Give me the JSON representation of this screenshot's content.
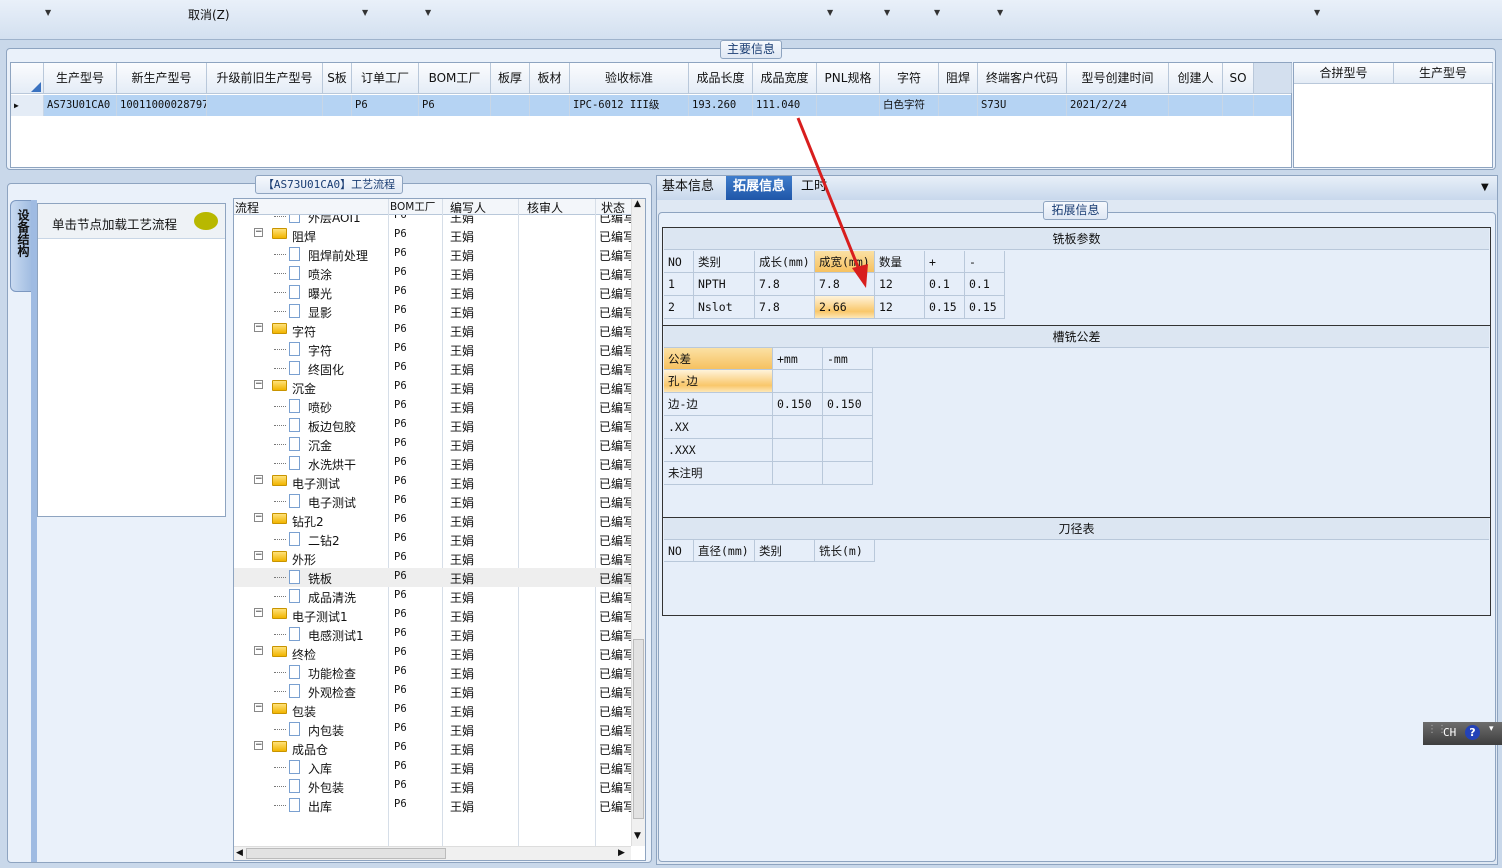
{
  "toolbar": {
    "cancel_label": "取消(Z)"
  },
  "main_info": {
    "title": "主要信息",
    "columns": [
      "生产型号",
      "新生产型号",
      "升级前旧生产型号",
      "S板",
      "订单工厂",
      "BOM工厂",
      "板厚",
      "板材",
      "验收标准",
      "成品长度",
      "成品宽度",
      "PNL规格",
      "字符",
      "阻焊",
      "终端客户代码",
      "型号创建时间",
      "创建人",
      "SO"
    ],
    "rows": [
      [
        "AS73U01CA0",
        "10011000028797",
        "",
        "",
        "P6",
        "P6",
        "",
        "",
        "IPC-6012 III级",
        "193.260",
        "111.040",
        "",
        "白色字符",
        "",
        "S73U",
        "2021/2/24",
        "",
        ""
      ]
    ],
    "merge_columns": [
      "合拼型号",
      "生产型号"
    ]
  },
  "process": {
    "title": "【AS73U01CA0】工艺流程",
    "side_tab": "设备结构",
    "hint": "单击节点加载工艺流程",
    "columns": [
      "流程",
      "BOM工厂",
      "编写人",
      "核审人",
      "状态"
    ],
    "rows": [
      {
        "name": "外层AOI1",
        "level": 2,
        "bom": "P6",
        "writer": "王娟",
        "reviewer": "",
        "status": "已编写"
      },
      {
        "name": "阻焊",
        "level": 1,
        "bom": "P6",
        "writer": "王娟",
        "reviewer": "",
        "status": "已编写"
      },
      {
        "name": "阻焊前处理",
        "level": 2,
        "bom": "P6",
        "writer": "王娟",
        "reviewer": "",
        "status": "已编写"
      },
      {
        "name": "喷涂",
        "level": 2,
        "bom": "P6",
        "writer": "王娟",
        "reviewer": "",
        "status": "已编写"
      },
      {
        "name": "曝光",
        "level": 2,
        "bom": "P6",
        "writer": "王娟",
        "reviewer": "",
        "status": "已编写"
      },
      {
        "name": "显影",
        "level": 2,
        "bom": "P6",
        "writer": "王娟",
        "reviewer": "",
        "status": "已编写"
      },
      {
        "name": "字符",
        "level": 1,
        "bom": "P6",
        "writer": "王娟",
        "reviewer": "",
        "status": "已编写"
      },
      {
        "name": "字符",
        "level": 2,
        "bom": "P6",
        "writer": "王娟",
        "reviewer": "",
        "status": "已编写"
      },
      {
        "name": "终固化",
        "level": 2,
        "bom": "P6",
        "writer": "王娟",
        "reviewer": "",
        "status": "已编写"
      },
      {
        "name": "沉金",
        "level": 1,
        "bom": "P6",
        "writer": "王娟",
        "reviewer": "",
        "status": "已编写"
      },
      {
        "name": "喷砂",
        "level": 2,
        "bom": "P6",
        "writer": "王娟",
        "reviewer": "",
        "status": "已编写"
      },
      {
        "name": "板边包胶",
        "level": 2,
        "bom": "P6",
        "writer": "王娟",
        "reviewer": "",
        "status": "已编写"
      },
      {
        "name": "沉金",
        "level": 2,
        "bom": "P6",
        "writer": "王娟",
        "reviewer": "",
        "status": "已编写"
      },
      {
        "name": "水洗烘干",
        "level": 2,
        "bom": "P6",
        "writer": "王娟",
        "reviewer": "",
        "status": "已编写"
      },
      {
        "name": "电子测试",
        "level": 1,
        "bom": "P6",
        "writer": "王娟",
        "reviewer": "",
        "status": "已编写"
      },
      {
        "name": "电子测试",
        "level": 2,
        "bom": "P6",
        "writer": "王娟",
        "reviewer": "",
        "status": "已编写"
      },
      {
        "name": "钻孔2",
        "level": 1,
        "bom": "P6",
        "writer": "王娟",
        "reviewer": "",
        "status": "已编写"
      },
      {
        "name": "二钻2",
        "level": 2,
        "bom": "P6",
        "writer": "王娟",
        "reviewer": "",
        "status": "已编写"
      },
      {
        "name": "外形",
        "level": 1,
        "bom": "P6",
        "writer": "王娟",
        "reviewer": "",
        "status": "已编写"
      },
      {
        "name": "铣板",
        "level": 2,
        "bom": "P6",
        "writer": "王娟",
        "reviewer": "",
        "status": "已编写",
        "selected": true
      },
      {
        "name": "成品清洗",
        "level": 2,
        "bom": "P6",
        "writer": "王娟",
        "reviewer": "",
        "status": "已编写"
      },
      {
        "name": "电子测试1",
        "level": 1,
        "bom": "P6",
        "writer": "王娟",
        "reviewer": "",
        "status": "已编写"
      },
      {
        "name": "电感测试1",
        "level": 2,
        "bom": "P6",
        "writer": "王娟",
        "reviewer": "",
        "status": "已编写"
      },
      {
        "name": "终检",
        "level": 1,
        "bom": "P6",
        "writer": "王娟",
        "reviewer": "",
        "status": "已编写"
      },
      {
        "name": "功能检查",
        "level": 2,
        "bom": "P6",
        "writer": "王娟",
        "reviewer": "",
        "status": "已编写"
      },
      {
        "name": "外观检查",
        "level": 2,
        "bom": "P6",
        "writer": "王娟",
        "reviewer": "",
        "status": "已编写"
      },
      {
        "name": "包装",
        "level": 1,
        "bom": "P6",
        "writer": "王娟",
        "reviewer": "",
        "status": "已编写"
      },
      {
        "name": "内包装",
        "level": 2,
        "bom": "P6",
        "writer": "王娟",
        "reviewer": "",
        "status": "已编写"
      },
      {
        "name": "成品仓",
        "level": 1,
        "bom": "P6",
        "writer": "王娟",
        "reviewer": "",
        "status": "已编写"
      },
      {
        "name": "入库",
        "level": 2,
        "bom": "P6",
        "writer": "王娟",
        "reviewer": "",
        "status": "已编写"
      },
      {
        "name": "外包装",
        "level": 2,
        "bom": "P6",
        "writer": "王娟",
        "reviewer": "",
        "status": "已编写"
      },
      {
        "name": "出库",
        "level": 2,
        "bom": "P6",
        "writer": "王娟",
        "reviewer": "",
        "status": "已编写"
      }
    ]
  },
  "detail": {
    "tabs": [
      "基本信息",
      "拓展信息",
      "工时"
    ],
    "active_tab": "拓展信息",
    "group_title": "拓展信息",
    "milling": {
      "title": "铣板参数",
      "columns": [
        "NO",
        "类别",
        "成长(mm)",
        "成宽(mm)",
        "数量",
        "+",
        "-"
      ],
      "rows": [
        [
          "1",
          "NPTH",
          "7.8",
          "7.8",
          "12",
          "0.1",
          "0.1"
        ],
        [
          "2",
          "Nslot",
          "7.8",
          "2.66",
          "12",
          "0.15",
          "0.15"
        ]
      ]
    },
    "tolerance": {
      "title": "槽铣公差",
      "columns": [
        "公差",
        "+mm",
        "-mm"
      ],
      "rows": [
        [
          "孔-边",
          "",
          ""
        ],
        [
          "边-边",
          "0.150",
          "0.150"
        ],
        [
          ".XX",
          "",
          ""
        ],
        [
          ".XXX",
          "",
          ""
        ],
        [
          "未注明",
          "",
          ""
        ]
      ]
    },
    "tools": {
      "title": "刀径表",
      "columns": [
        "NO",
        "直径(mm)",
        "类别",
        "铣长(m)"
      ]
    }
  },
  "ime": {
    "label": "CH"
  },
  "colors": {
    "accent": "#2a66b8",
    "selection": "#b5d3f3",
    "highlight": "#f6c160",
    "arrow": "#d81e1e"
  }
}
